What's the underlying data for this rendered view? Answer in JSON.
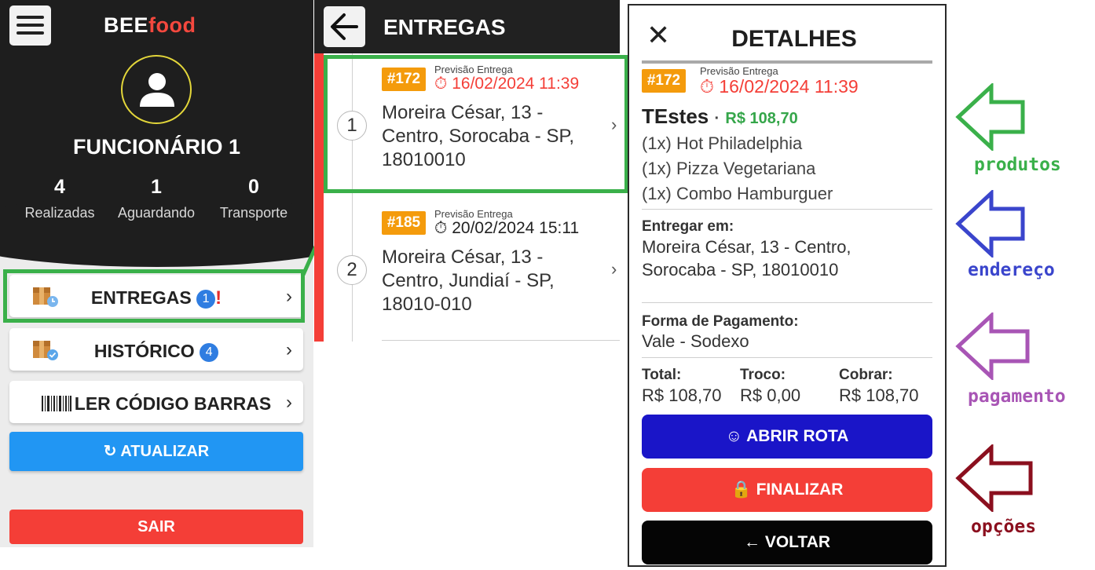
{
  "colors": {
    "dark": "#1e1e1e",
    "accent_red": "#f43e37",
    "green": "#3ab04a",
    "blue": "#2196f3",
    "order_tag": "#f49b0c",
    "route_blue": "#1a15c8"
  },
  "home": {
    "menu_icon": "hamburger-icon",
    "logo_bee": "BEE",
    "logo_food": "food",
    "employee_name": "FUNCIONÁRIO 1",
    "stats": [
      {
        "value": "4",
        "label": "Realizadas"
      },
      {
        "value": "1",
        "label": "Aguardando"
      },
      {
        "value": "0",
        "label": "Transporte"
      }
    ],
    "menu": {
      "entregas_label": "ENTREGAS",
      "entregas_badge": "1",
      "entregas_alert": "!",
      "historico_label": "HISTÓRICO",
      "historico_badge": "4",
      "barcode_label": "LER CÓDIGO BARRAS"
    },
    "refresh_label": "ATUALIZAR",
    "logout_label": "SAIR"
  },
  "deliveries": {
    "title": "ENTREGAS",
    "forecast_label": "Previsão Entrega",
    "items": [
      {
        "index": "1",
        "order": "#172",
        "date": "16/02/2024 11:39",
        "address_line1": "Moreira César, 13 -",
        "address_line2": "Centro, Sorocaba - SP,",
        "address_line3": "18010010"
      },
      {
        "index": "2",
        "order": "#185",
        "date": "20/02/2024 15:11",
        "address_line1": "Moreira César, 13 -",
        "address_line2": "Centro, Jundiaí - SP,",
        "address_line3": "18010-010"
      }
    ]
  },
  "details": {
    "title": "DETALHES",
    "order": "#172",
    "forecast_label": "Previsão Entrega",
    "date": "16/02/2024 11:39",
    "client": "TEstes",
    "separator": "·",
    "price": "R$ 108,70",
    "items": [
      "(1x) Hot Philadelphia",
      "(1x) Pizza Vegetariana",
      "(1x) Combo Hamburguer"
    ],
    "deliver_label": "Entregar em:",
    "deliver_line1": "Moreira César, 13 - Centro,",
    "deliver_line2": "Sorocaba - SP, 18010010",
    "payment_label": "Forma de Pagamento:",
    "payment_value": "Vale - Sodexo",
    "total_label": "Total:",
    "total_value": "R$ 108,70",
    "change_label": "Troco:",
    "change_value": "R$ 0,00",
    "charge_label": "Cobrar:",
    "charge_value": "R$ 108,70",
    "route_label": "ABRIR ROTA",
    "finish_label": "FINALIZAR",
    "back_label": "VOLTAR"
  },
  "annotations": [
    {
      "label": "produtos",
      "color": "#3ab04a"
    },
    {
      "label": "endereço",
      "color": "#3a45cc"
    },
    {
      "label": "pagamento",
      "color": "#a855b5"
    },
    {
      "label": "opções",
      "color": "#8b0f1e"
    }
  ]
}
